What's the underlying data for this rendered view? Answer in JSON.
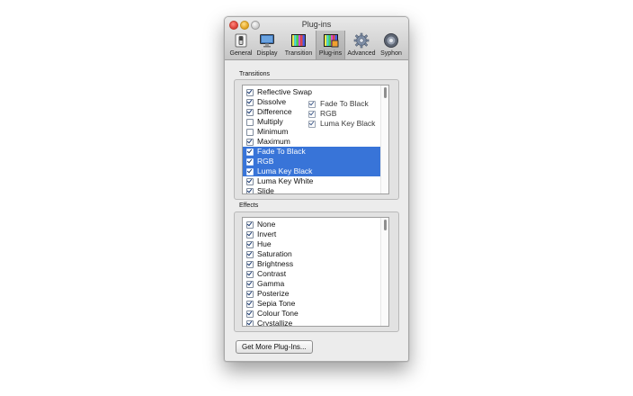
{
  "window": {
    "title": "Plug-ins"
  },
  "toolbar": {
    "items": [
      {
        "label": "General",
        "icon": "switch-icon",
        "active": false
      },
      {
        "label": "Display",
        "icon": "monitor-icon",
        "active": false
      },
      {
        "label": "Transition",
        "icon": "transition-icon",
        "active": false
      },
      {
        "label": "Plug-ins",
        "icon": "plugins-icon",
        "active": true
      },
      {
        "label": "Advanced",
        "icon": "gear-icon",
        "active": false
      },
      {
        "label": "Syphon",
        "icon": "syphon-icon",
        "active": false
      }
    ]
  },
  "transitions": {
    "label": "Transitions",
    "items": [
      {
        "label": "Reflective Swap",
        "checked": true,
        "selected": false
      },
      {
        "label": "Dissolve",
        "checked": true,
        "selected": false
      },
      {
        "label": "Difference",
        "checked": true,
        "selected": false
      },
      {
        "label": "Multiply",
        "checked": false,
        "selected": false
      },
      {
        "label": "Minimum",
        "checked": false,
        "selected": false
      },
      {
        "label": "Maximum",
        "checked": true,
        "selected": false
      },
      {
        "label": "Fade To Black",
        "checked": true,
        "selected": true
      },
      {
        "label": "RGB",
        "checked": true,
        "selected": true
      },
      {
        "label": "Luma Key Black",
        "checked": true,
        "selected": true
      },
      {
        "label": "Luma Key White",
        "checked": true,
        "selected": false
      },
      {
        "label": "Slide",
        "checked": true,
        "selected": false
      }
    ],
    "drag_preview": [
      {
        "label": "Fade To Black",
        "checked": true
      },
      {
        "label": "RGB",
        "checked": true
      },
      {
        "label": "Luma Key Black",
        "checked": true
      }
    ]
  },
  "effects": {
    "label": "Effects",
    "items": [
      {
        "label": "None",
        "checked": true
      },
      {
        "label": "Invert",
        "checked": true
      },
      {
        "label": "Hue",
        "checked": true
      },
      {
        "label": "Saturation",
        "checked": true
      },
      {
        "label": "Brightness",
        "checked": true
      },
      {
        "label": "Contrast",
        "checked": true
      },
      {
        "label": "Gamma",
        "checked": true
      },
      {
        "label": "Posterize",
        "checked": true
      },
      {
        "label": "Sepia Tone",
        "checked": true
      },
      {
        "label": "Colour Tone",
        "checked": true
      },
      {
        "label": "Crystallize",
        "checked": true
      }
    ]
  },
  "buttons": {
    "get_more": "Get More Plug-Ins..."
  },
  "colors": {
    "selection": "#3874d8",
    "window": "#ececec"
  }
}
